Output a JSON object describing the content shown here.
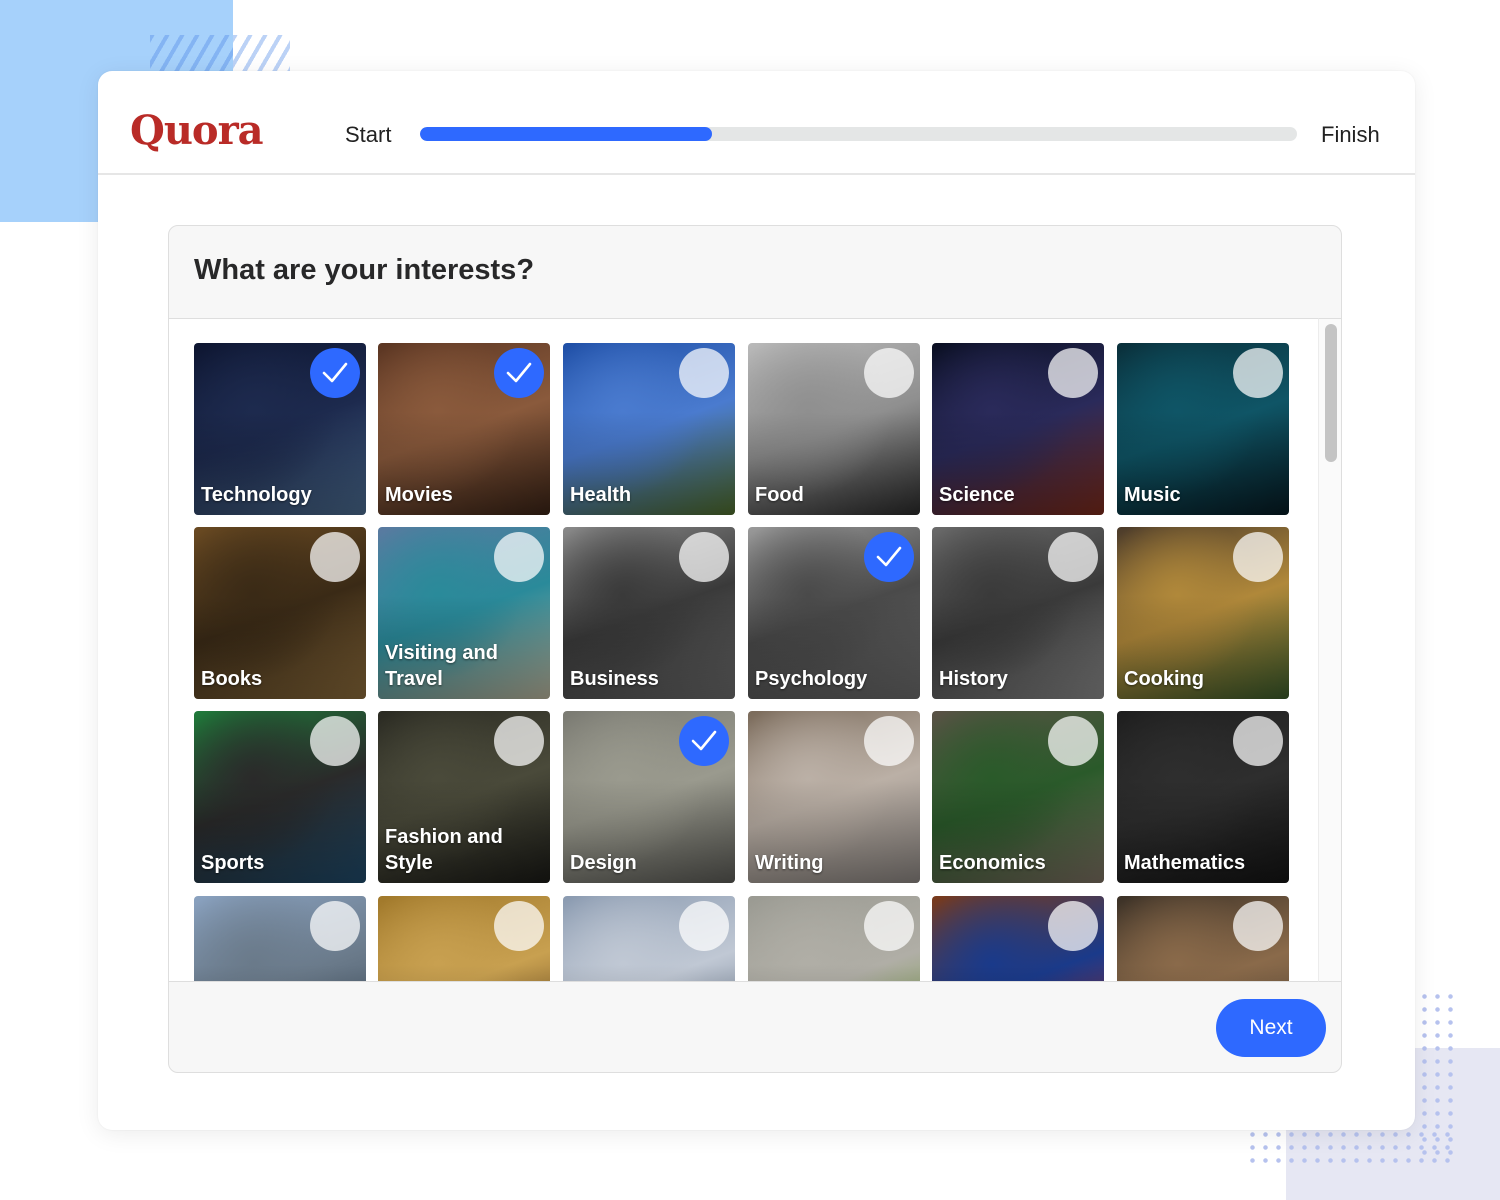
{
  "header": {
    "logo": "Quora",
    "step_start": "Start",
    "step_finish": "Finish",
    "progress_fraction": 0.333,
    "accent_color": "#2e69ff",
    "brand_color": "#b92b27"
  },
  "panel": {
    "title": "What are your interests?",
    "next_label": "Next"
  },
  "topics": [
    {
      "label": "Technology",
      "selected": true,
      "colors": [
        "#0d1530",
        "#1d2a4e",
        "#4a6a8e"
      ]
    },
    {
      "label": "Movies",
      "selected": true,
      "colors": [
        "#5a3522",
        "#8a5a3c",
        "#3a2316"
      ]
    },
    {
      "label": "Health",
      "selected": false,
      "colors": [
        "#1f4fa6",
        "#4a7bcf",
        "#4e6b2a"
      ]
    },
    {
      "label": "Food",
      "selected": false,
      "colors": [
        "#b9b9b9",
        "#8f8f8f",
        "#2a2a2a"
      ]
    },
    {
      "label": "Science",
      "selected": false,
      "colors": [
        "#0a0f22",
        "#2a2a5a",
        "#7a2a1a"
      ]
    },
    {
      "label": "Music",
      "selected": false,
      "colors": [
        "#0a2f3a",
        "#0f5566",
        "#061a22"
      ]
    },
    {
      "label": "Books",
      "selected": false,
      "colors": [
        "#6a4a22",
        "#3a2a16",
        "#8a6a3a"
      ]
    },
    {
      "label": "Visiting and Travel",
      "selected": false,
      "colors": [
        "#5a7aa0",
        "#2a8a9a",
        "#b8b29a"
      ]
    },
    {
      "label": "Business",
      "selected": false,
      "colors": [
        "#8a8a8a",
        "#3a3a3a",
        "#6a6a6a"
      ]
    },
    {
      "label": "Psychology",
      "selected": true,
      "colors": [
        "#9a9a9a",
        "#4a4a4a",
        "#6a6a6a"
      ]
    },
    {
      "label": "History",
      "selected": false,
      "colors": [
        "#6a6a6a",
        "#3a3a3a",
        "#8a8a8a"
      ]
    },
    {
      "label": "Cooking",
      "selected": false,
      "colors": [
        "#4a3a2a",
        "#b0883a",
        "#3a5a2a"
      ]
    },
    {
      "label": "Sports",
      "selected": false,
      "colors": [
        "#1f7a3a",
        "#2a2a2a",
        "#1f4a6a"
      ]
    },
    {
      "label": "Fashion and Style",
      "selected": false,
      "colors": [
        "#2a2a22",
        "#4a4a3a",
        "#1a1a16"
      ]
    },
    {
      "label": "Design",
      "selected": true,
      "colors": [
        "#7a7a72",
        "#9a9a8e",
        "#5a5a55"
      ]
    },
    {
      "label": "Writing",
      "selected": false,
      "colors": [
        "#7a6a5a",
        "#bbb0a6",
        "#8a8480"
      ]
    },
    {
      "label": "Economics",
      "selected": false,
      "colors": [
        "#5a5246",
        "#2a5a2a",
        "#7a6e60"
      ]
    },
    {
      "label": "Mathematics",
      "selected": false,
      "colors": [
        "#1e1e1e",
        "#2e2e2e",
        "#141414"
      ]
    },
    {
      "label": "",
      "selected": false,
      "colors": [
        "#8aa2c0",
        "#6a7a8a",
        "#3a4a5a"
      ]
    },
    {
      "label": "",
      "selected": false,
      "colors": [
        "#a0782a",
        "#c8a050",
        "#5a3a16"
      ]
    },
    {
      "label": "",
      "selected": false,
      "colors": [
        "#8a9ab0",
        "#c0c8d4",
        "#5a6a80"
      ]
    },
    {
      "label": "",
      "selected": false,
      "colors": [
        "#9a9a92",
        "#b0aea6",
        "#6a9a2a"
      ]
    },
    {
      "label": "",
      "selected": false,
      "colors": [
        "#7a3a1a",
        "#1a3a8a",
        "#b02a2a"
      ]
    },
    {
      "label": "",
      "selected": false,
      "colors": [
        "#3a3026",
        "#8a6a4a",
        "#5a4a3a"
      ]
    }
  ]
}
